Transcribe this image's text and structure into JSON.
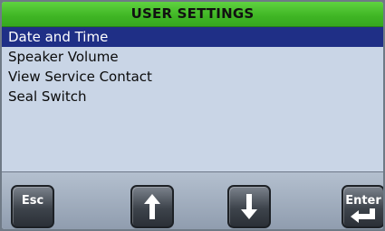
{
  "header": {
    "title": "USER SETTINGS"
  },
  "menu": {
    "items": [
      {
        "label": "Date and Time",
        "selected": true
      },
      {
        "label": "Speaker Volume",
        "selected": false
      },
      {
        "label": "View Service Contact",
        "selected": false
      },
      {
        "label": "Seal Switch",
        "selected": false
      }
    ]
  },
  "softkeys": {
    "esc": {
      "label": "Esc"
    },
    "up": {
      "icon": "arrow-up-icon"
    },
    "down": {
      "icon": "arrow-down-icon"
    },
    "enter": {
      "label": "Enter",
      "icon": "enter-return-icon"
    }
  },
  "colors": {
    "title_bar": "#3fb524",
    "selection": "#1f2f86",
    "menu_background": "#c9d5e6"
  }
}
